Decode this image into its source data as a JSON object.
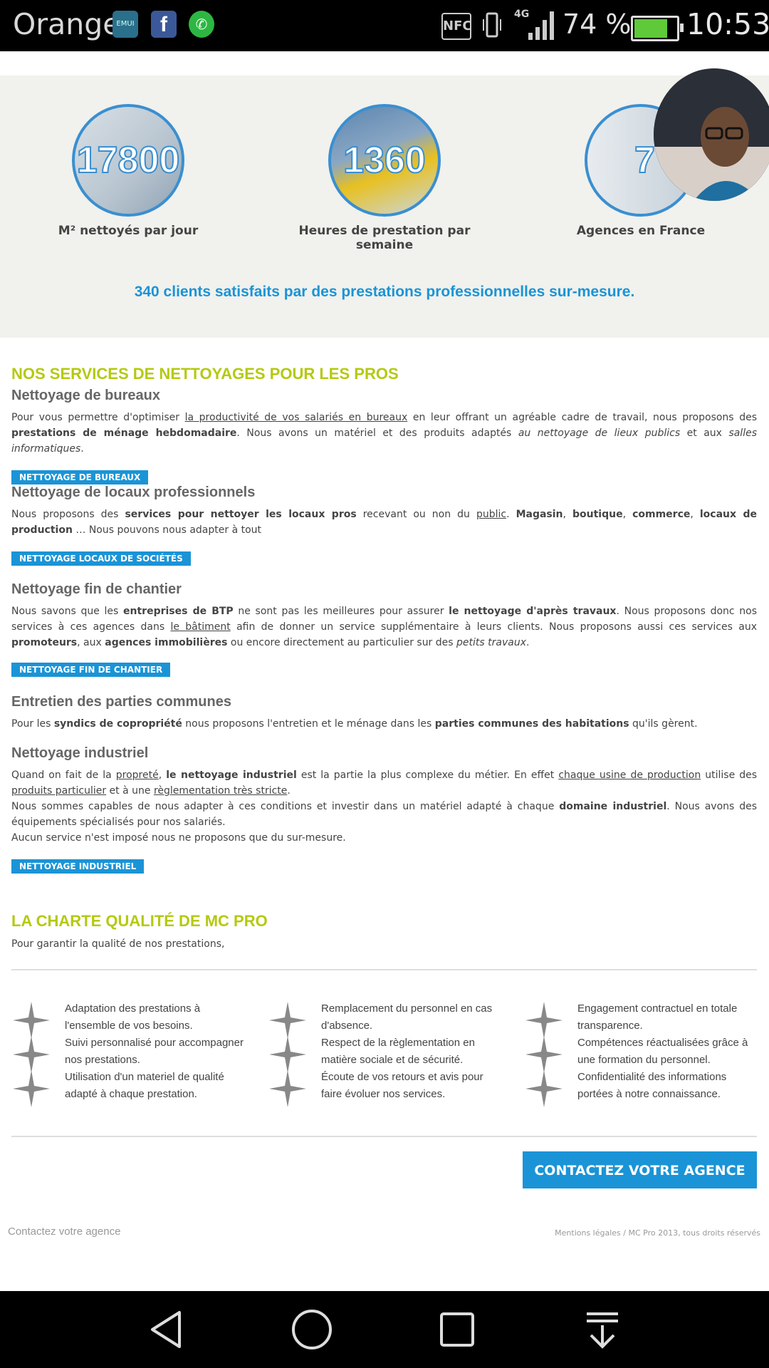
{
  "status_bar": {
    "carrier": "Orange",
    "apps": [
      "EMUI",
      "f",
      "whatsapp-icon"
    ],
    "nfc": "NFC",
    "network": "4G",
    "battery_percent": "74 %",
    "battery_level": 0.74,
    "time": "10:53"
  },
  "stats": [
    {
      "value": "17800",
      "label": "M² nettoyés par jour"
    },
    {
      "value": "1360",
      "label": "Heures de prestation par semaine"
    },
    {
      "value": "7",
      "label": "Agences en France"
    }
  ],
  "tagline": "340 clients satisfaits par des prestations professionnelles sur-mesure.",
  "services": {
    "title": "NOS SERVICES DE NETTOYAGES POUR LES PROS",
    "items": [
      {
        "heading": "Nettoyage de bureaux",
        "button": "NETTOYAGE DE BUREAUX"
      },
      {
        "heading": "Nettoyage de locaux professionnels",
        "button": "NETTOYAGE LOCAUX DE SOCIÉTÉS"
      },
      {
        "heading": "Nettoyage fin de chantier",
        "button": "NETTOYAGE FIN DE CHANTIER"
      },
      {
        "heading": "Entretien des parties communes"
      },
      {
        "heading": "Nettoyage industriel",
        "button": "NETTOYAGE INDUSTRIEL"
      }
    ],
    "p1": {
      "a": "Pour vous permettre d'optimiser ",
      "b": "la productivité de vos salariés en bureaux",
      "c": " en leur offrant un agréable cadre de travail, nous proposons des ",
      "d": "prestations de ménage hebdomadaire",
      "e": ". Nous avons un matériel et des produits adaptés ",
      "f": "au nettoyage de lieux publics",
      "g": " et aux ",
      "h": "salles informatiques",
      "i": "."
    },
    "p2": {
      "a": "Nous proposons des ",
      "b": "services pour nettoyer les locaux pros",
      "c": " recevant ou non du ",
      "d": "public",
      "e": ". ",
      "f": "Magasin",
      "g": ", ",
      "h": "boutique",
      "i": ", ",
      "j": "commerce",
      "k": ", ",
      "l": "locaux de production",
      "m": " … Nous pouvons nous adapter à tout"
    },
    "p3": {
      "a": "Nous savons que les ",
      "b": "entreprises de BTP",
      "c": " ne sont pas les meilleures pour assurer ",
      "d": "le nettoyage d'après travaux",
      "e": ". Nous proposons donc nos services à ces agences dans ",
      "f": "le bâtiment",
      "g": " afin de donner un service supplémentaire à leurs clients. Nous proposons aussi ces services aux ",
      "h": "promoteurs",
      "i": ", aux ",
      "j": "agences immobilières",
      "k": " ou encore directement au particulier sur des ",
      "l": "petits travaux",
      "m": "."
    },
    "p4": {
      "a": "Pour les ",
      "b": "syndics de copropriété",
      "c": " nous proposons l'entretien et le ménage dans les ",
      "d": "parties communes des habitations",
      "e": " qu'ils gèrent."
    },
    "p5": {
      "a": "Quand on fait de la ",
      "b": "propreté",
      "c": ", ",
      "d": "le nettoyage industriel",
      "e": " est la partie la plus complexe du métier. En effet ",
      "f": "chaque usine de production",
      "g": " utilise des ",
      "h": "produits particulier",
      "i": " et à une ",
      "j": "règlementation très stricte",
      "k": ".",
      "line2a": "Nous sommes capables de nous adapter à ces conditions et investir dans un matériel adapté à chaque ",
      "line2b": "domaine industriel",
      "line2c": ". Nous avons des équipements spécialisés pour nos salariés.",
      "line3": "Aucun service n'est imposé nous ne proposons que du sur-mesure."
    }
  },
  "quality": {
    "title": "LA CHARTE QUALITÉ DE MC PRO",
    "intro": "Pour garantir la qualité de nos prestations,",
    "columns": [
      [
        "Adaptation des prestations à l'ensemble de vos besoins.",
        "Suivi personnalisé pour accompagner nos prestations.",
        "Utilisation d'un materiel de qualité adapté à chaque prestation."
      ],
      [
        "Remplacement du personnel en cas d'absence.",
        "Respect de la règlementation en matière sociale et de sécurité.",
        "Écoute de vos retours et avis pour faire évoluer nos services."
      ],
      [
        "Engagement contractuel en totale transparence.",
        "Compétences réactualisées grâce à une formation du personnel.",
        "Confidentialité des informations portées à notre connaissance."
      ]
    ]
  },
  "cta": "CONTACTEZ VOTRE AGENCE",
  "footer": {
    "left": "Contactez votre agence",
    "right": "Mentions légales / MC Pro 2013, tous droits réservés"
  },
  "colors": {
    "accent": "#1a94d6",
    "heading_green": "#b5c90f",
    "band": "#f1f1ed"
  }
}
